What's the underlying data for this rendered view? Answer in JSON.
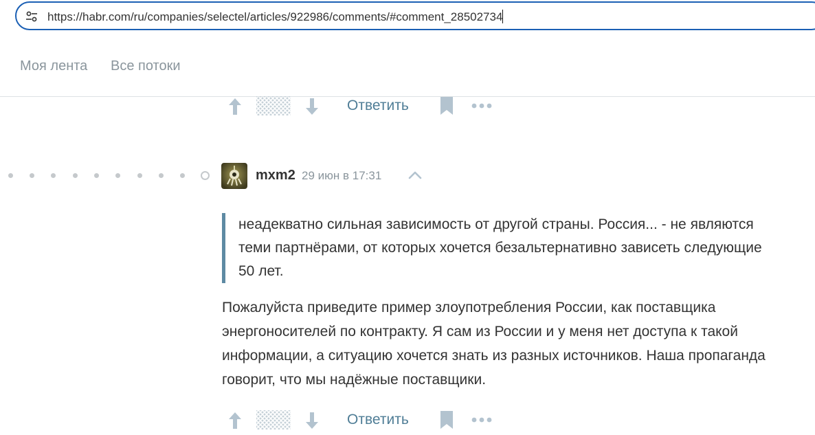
{
  "browser": {
    "url": "https://habr.com/ru/companies/selectel/articles/922986/comments/#comment_28502734"
  },
  "nav": {
    "items": [
      {
        "label": "Моя лента"
      },
      {
        "label": "Все потоки"
      }
    ]
  },
  "actions": {
    "reply_label": "Ответить"
  },
  "comment": {
    "author": "mxm2",
    "date": "29 июн в 17:31",
    "quote": "неадекватно сильная зависимость от другой страны. Россия... - не являются теми партнёрами, от которых хочется безальтернативно зависеть следующие 50 лет.",
    "body": "Пожалуйста приведите пример злоупотребления России, как поставщика энергоносителей по контракту. Я сам из России и у меня нет доступа к такой информации, а ситуацию хочется знать из разных источников. Наша пропаганда говорит, что мы надёжные поставщики."
  },
  "colors": {
    "accent": "#5e8aa3",
    "link": "#4f7d96",
    "muted": "#8a959c",
    "icon": "#b3c3cf",
    "url_focus": "#1a5fb4"
  }
}
